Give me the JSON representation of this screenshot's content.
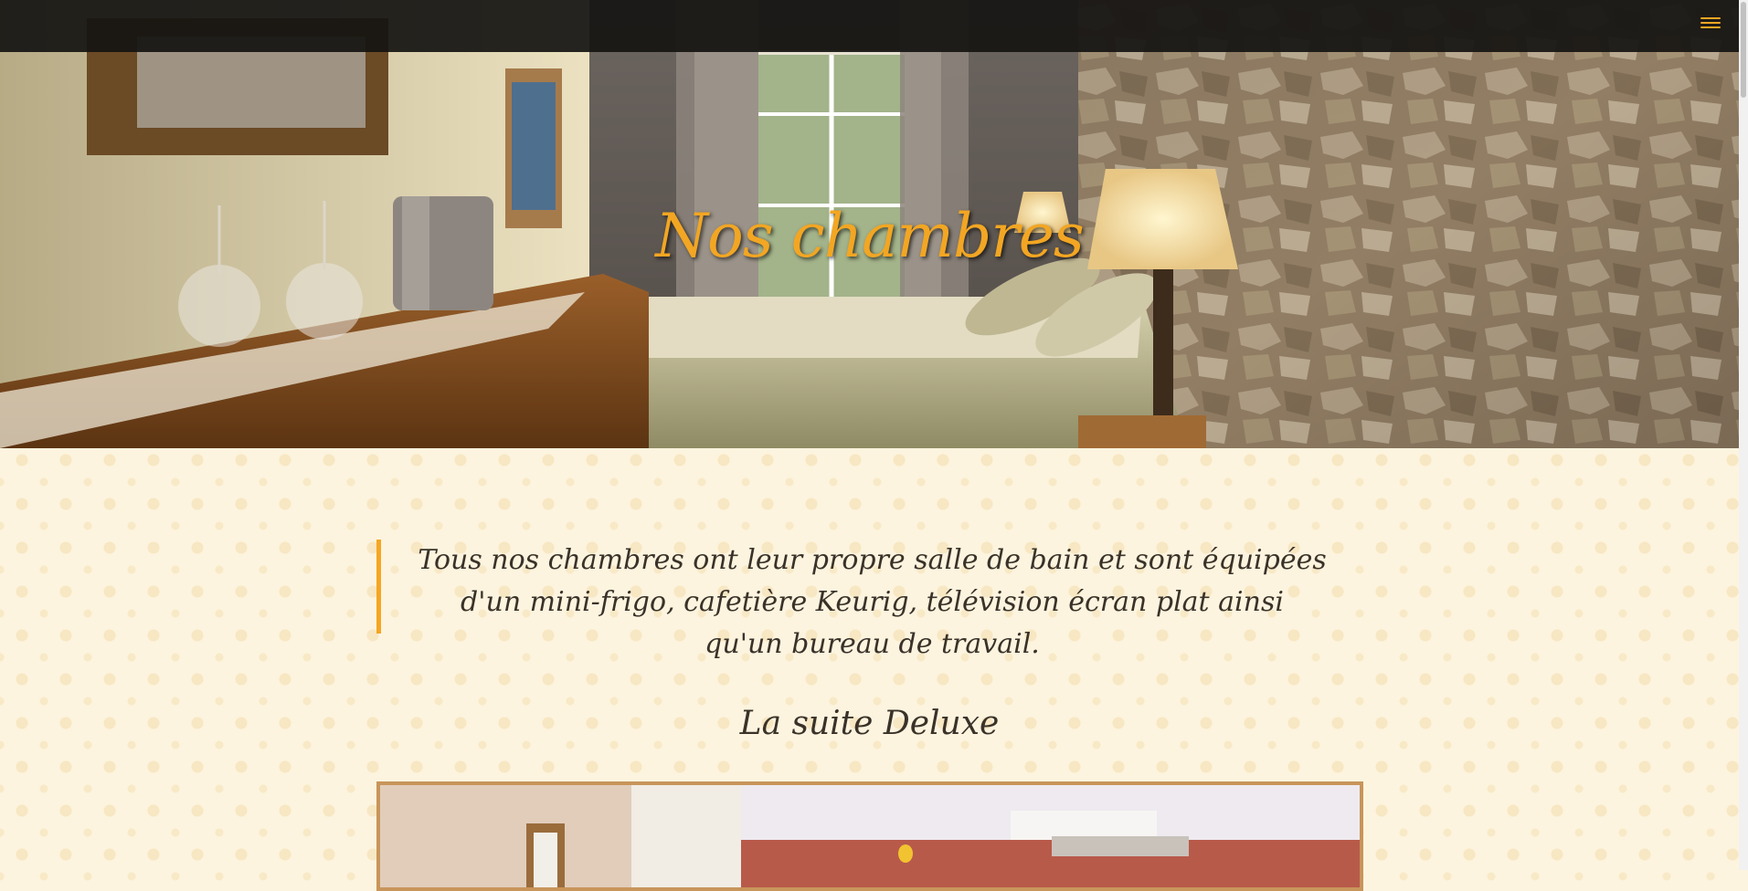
{
  "header": {
    "menu_icon": "hamburger-menu-icon",
    "accent_color": "#f5a623"
  },
  "hero": {
    "title": "Nos chambres"
  },
  "intro": {
    "quote": "Tous nos chambres ont leur propre salle de bain et sont équipées d'un mini-frigo, cafetière Keurig, télévision écran plat ainsi qu'un bureau de travail."
  },
  "rooms": {
    "first_title": "La suite Deluxe"
  }
}
